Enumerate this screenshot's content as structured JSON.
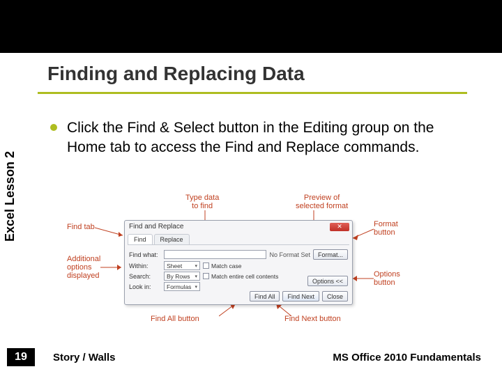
{
  "slide": {
    "title": "Finding and Replacing Data",
    "sidebar_label": "Excel Lesson 2",
    "page_number": "19",
    "footer_left": "Story / Walls",
    "footer_right": "MS Office 2010 Fundamentals",
    "bullet": "Click the Find & Select button in the Editing group on the Home tab to access the Find and Replace commands."
  },
  "callouts": {
    "find_tab": "Find tab",
    "type_data": "Type data\nto find",
    "preview_fmt": "Preview of\nselected format",
    "format_btn": "Format\nbutton",
    "additional": "Additional\noptions\ndisplayed",
    "options_btn": "Options\nbutton",
    "findall_btn": "Find All button",
    "findnext_btn": "Find Next button"
  },
  "dialog": {
    "title": "Find and Replace",
    "tabs": {
      "find": "Find",
      "replace": "Replace"
    },
    "find_what_label": "Find what:",
    "no_format": "No Format Set",
    "format_btn": "Format...",
    "within_label": "Within:",
    "within_val": "Sheet",
    "search_label": "Search:",
    "search_val": "By Rows",
    "lookin_label": "Look in:",
    "lookin_val": "Formulas",
    "match_case": "Match case",
    "match_entire": "Match entire cell contents",
    "options_btn": "Options <<",
    "find_all": "Find All",
    "find_next": "Find Next",
    "close": "Close",
    "close_x": "✕"
  }
}
